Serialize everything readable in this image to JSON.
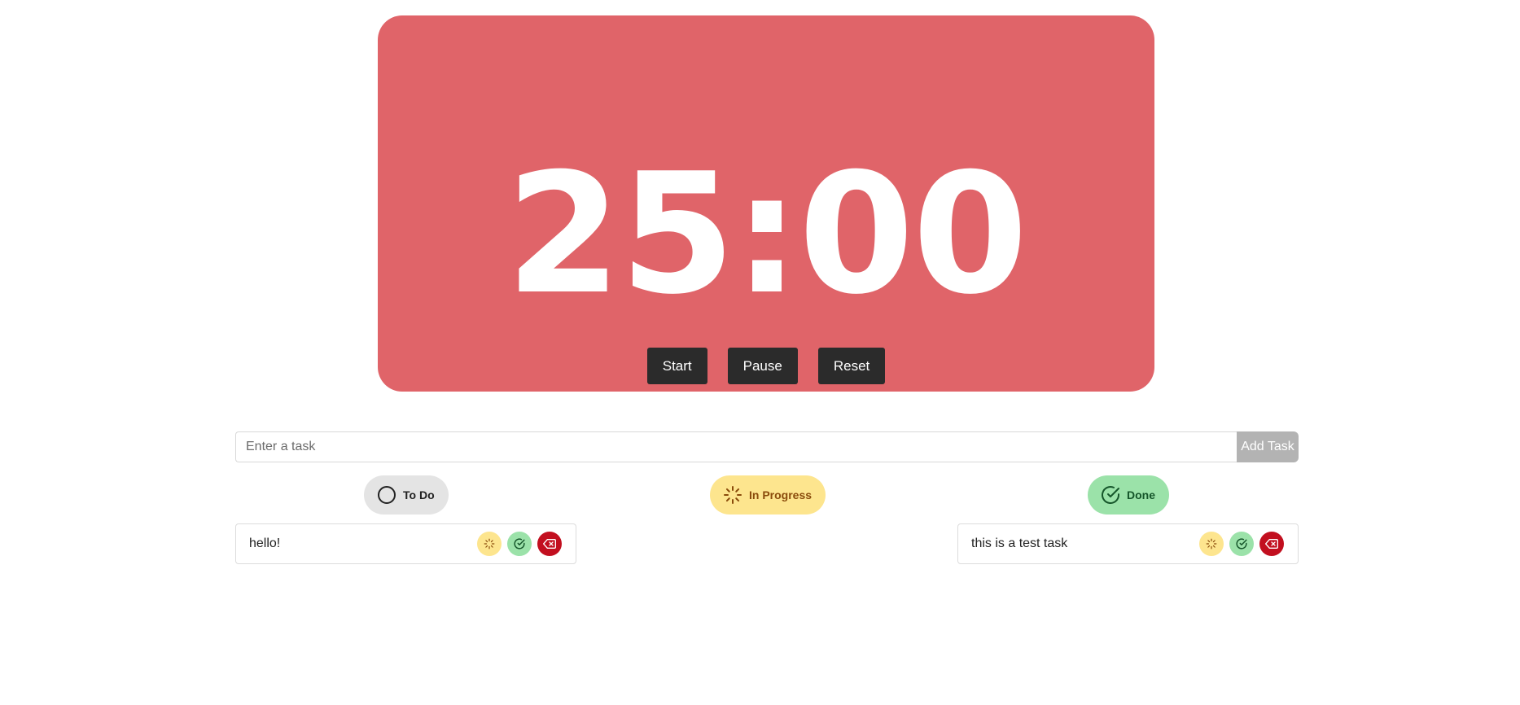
{
  "timer": {
    "display": "25:00",
    "start_label": "Start",
    "pause_label": "Pause",
    "reset_label": "Reset",
    "background_color": "#e06469"
  },
  "task_form": {
    "placeholder": "Enter a task",
    "value": "",
    "add_label": "Add Task"
  },
  "columns": {
    "todo": {
      "label": "To Do",
      "icon": "circle-icon",
      "color": "#e4e4e4"
    },
    "in_progress": {
      "label": "In Progress",
      "icon": "loader-icon",
      "color": "#fde58e"
    },
    "done": {
      "label": "Done",
      "icon": "check-circle-icon",
      "color": "#9be2a9"
    }
  },
  "tasks": {
    "todo": [
      {
        "text": "hello!"
      }
    ],
    "in_progress": [],
    "done": [
      {
        "text": "this is a test task"
      }
    ]
  },
  "task_action_icons": [
    "loader-icon",
    "check-circle-icon",
    "delete-icon"
  ]
}
